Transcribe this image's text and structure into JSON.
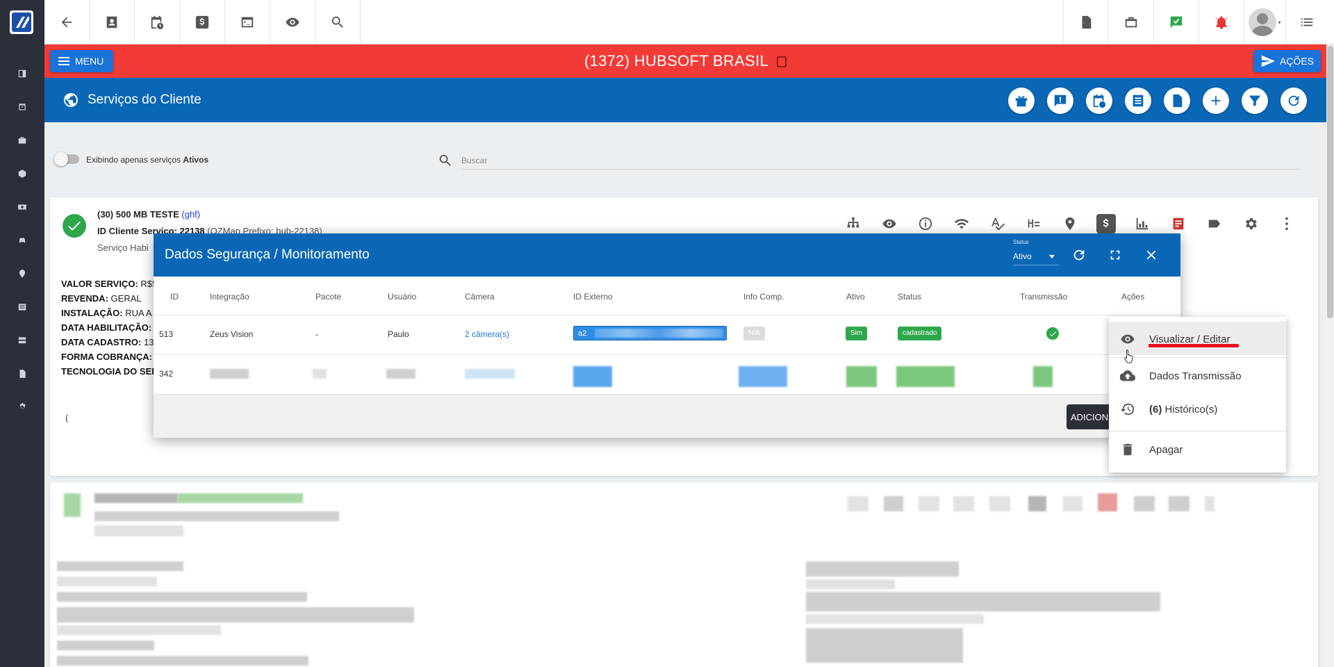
{
  "topbar": {
    "right_icons": [
      "pdf-icon",
      "briefcase-icon",
      "chat-check-icon",
      "alarm-bell-icon",
      "avatar",
      "list-icon"
    ]
  },
  "header": {
    "menu_label": "MENU",
    "client_title": "(1372) HUBSOFT BRASIL",
    "actions_label": "AÇÕES",
    "accent_color": "#f23a36"
  },
  "page": {
    "title": "Serviços do Cliente"
  },
  "filter": {
    "toggle_label_prefix": "Exibindo apenas serviços ",
    "toggle_label_strong": "Ativos",
    "search_placeholder": "Buscar"
  },
  "service": {
    "name": "(30) 500 MB TESTE",
    "code": "(ghf)",
    "id_label": "ID Cliente Serviço: 22138",
    "id_extra": "(OZMap Prefixo: hub-22138)",
    "status_line": "Serviço Habi",
    "fields": [
      {
        "label": "VALOR SERVIÇO:",
        "value": "R$5"
      },
      {
        "label": "REVENDA:",
        "value": "GERAL"
      },
      {
        "label": "INSTALAÇÃO:",
        "value": "RUA A"
      },
      {
        "label": "DATA HABILITAÇÃO:",
        "value": ""
      },
      {
        "label": "DATA CADASTRO:",
        "value": "13"
      },
      {
        "label": "FORMA COBRANÇA:",
        "value": ""
      },
      {
        "label": "TECNOLOGIA DO SER",
        "value": ""
      }
    ],
    "paren": "("
  },
  "modal": {
    "title": "Dados Segurança / Monitoramento",
    "status_label": "Status",
    "status_value": "Ativo",
    "columns": [
      "ID",
      "Integração",
      "Pacote",
      "Usuário",
      "Câmera",
      "ID Externo",
      "Info Comp.",
      "Ativo",
      "Status",
      "Transmissão",
      "Ações"
    ],
    "row1": {
      "id": "513",
      "integracao": "Zeus Vision",
      "pacote": "-",
      "usuario": "Paulo",
      "camera": "2 câmera(s)",
      "id_externo": "a2",
      "info_comp": "N/A",
      "ativo": "Sim",
      "status": "cadastrado"
    },
    "row2": {
      "id": "342"
    },
    "add_button": "ADICION"
  },
  "context_menu": {
    "items": [
      {
        "label": "Visualizar / Editar",
        "icon": "eye-icon"
      },
      {
        "label": "Dados Transmissão",
        "icon": "cloud-upload-icon"
      },
      {
        "label_count": "(6)",
        "label": " Histórico(s)",
        "icon": "history-icon"
      },
      {
        "label": "Apagar",
        "icon": "trash-icon"
      }
    ]
  }
}
